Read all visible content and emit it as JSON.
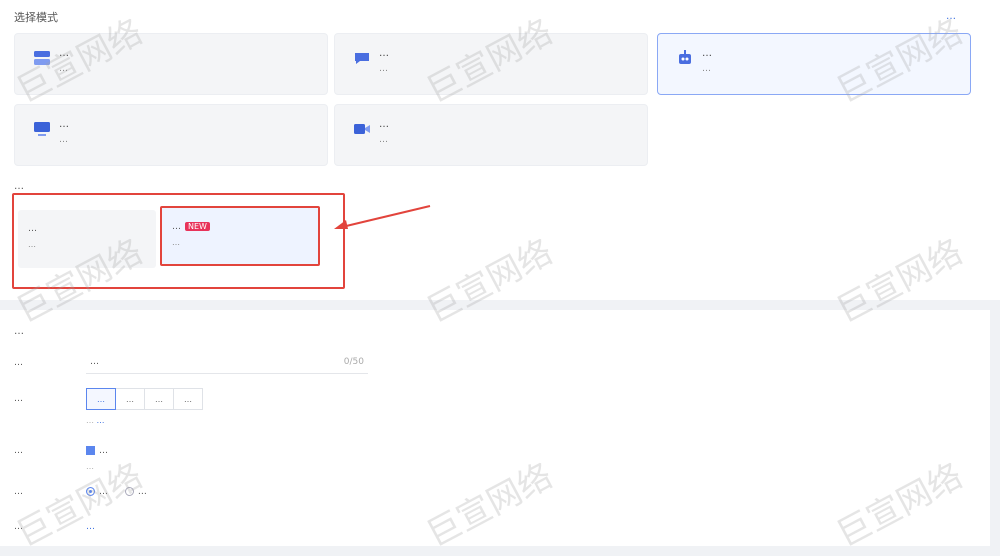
{
  "header": {
    "section_title": "选择模式",
    "top_link": "…"
  },
  "mode_cards": [
    {
      "title": "…",
      "desc": "…",
      "icon": "server-icon",
      "color": "#4a6ee0"
    },
    {
      "title": "…",
      "desc": "…",
      "icon": "chat-icon",
      "color": "#4a6ee0"
    },
    {
      "title": "…",
      "desc": "…",
      "icon": "robot-icon",
      "color": "#4a6ee0",
      "selected": true
    },
    {
      "title": "…",
      "desc": "…",
      "icon": "monitor-icon",
      "color": "#3b62d8"
    },
    {
      "title": "…",
      "desc": "…",
      "icon": "video-icon",
      "color": "#3b62d8"
    }
  ],
  "sub_section": {
    "title": "…",
    "options": [
      {
        "title": "…",
        "desc": "…"
      },
      {
        "title": "…",
        "tag": "NEW",
        "desc": "…",
        "selected": true
      }
    ]
  },
  "form": {
    "title": "…",
    "name_label": "…",
    "name_value": "…",
    "name_suffix": "0/50",
    "type_label": "…",
    "type_options": [
      "…",
      "…",
      "…",
      "…"
    ],
    "type_active_index": 0,
    "type_hint": "…",
    "type_hint_link": "…",
    "enable_label": "…",
    "enable_value": "…",
    "enable_hint": "…",
    "mode_label": "…",
    "mode_options": [
      "…",
      "…"
    ],
    "mode_active_index": 0,
    "adv_label": "…",
    "adv_link": "…"
  },
  "watermark_text": "巨宣网络"
}
